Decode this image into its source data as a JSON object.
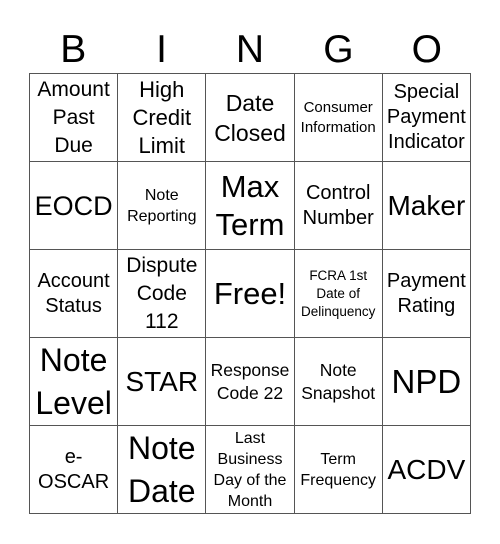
{
  "header": {
    "letters": [
      "B",
      "I",
      "N",
      "G",
      "O"
    ]
  },
  "card": {
    "rows": [
      [
        "Amount\nPast\nDue",
        "High\nCredit\nLimit",
        "Date\nClosed",
        "Consumer\nInformation",
        "Special\nPayment\nIndicator"
      ],
      [
        "EOCD",
        "Note\nReporting",
        "Max\nTerm",
        "Control\nNumber",
        "Maker"
      ],
      [
        "Account\nStatus",
        "Dispute\nCode\n112",
        "Free!",
        "FCRA 1st\nDate of\nDelinquency",
        "Payment\nRating"
      ],
      [
        "Note\nLevel",
        "STAR",
        "Response\nCode 22",
        "Note\nSnapshot",
        "NPD"
      ],
      [
        "e-\nOSCAR",
        "Note\nDate",
        "Last\nBusiness\nDay of the\nMonth",
        "Term\nFrequency",
        "ACDV"
      ]
    ]
  }
}
